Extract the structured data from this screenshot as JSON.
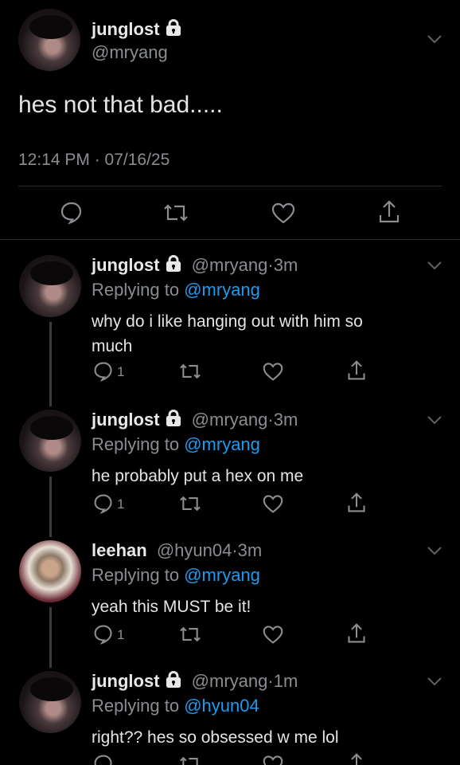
{
  "main_tweet": {
    "name": "junglost",
    "handle": "@mryang",
    "text": "hes not that bad.....",
    "timestamp": "12:14 PM · 07/16/25",
    "icons": [
      "lock-icon",
      "chevron-down-icon",
      "reply-icon",
      "retweet-icon",
      "like-icon",
      "share-icon"
    ]
  },
  "replies": [
    {
      "name": "junglost",
      "handle": "@mryang",
      "dot": "·",
      "time": "3m",
      "replying_prefix": "Replying to",
      "replying_to": "@mryang",
      "text_line1": "why do i like hanging out with him so",
      "text_line2": "much",
      "reply_count": "1",
      "locked": true
    },
    {
      "name": "junglost",
      "handle": "@mryang",
      "dot": "·",
      "time": "3m",
      "replying_prefix": "Replying to",
      "replying_to": "@mryang",
      "text_line1": "he probably put a hex on me",
      "reply_count": "1",
      "locked": true
    },
    {
      "name": "leehan",
      "handle": "@hyun04",
      "dot": "·",
      "time": "3m",
      "replying_prefix": "Replying to",
      "replying_to": "@mryang",
      "text_line1": "yeah this MUST be it!",
      "reply_count": "1",
      "locked": false
    },
    {
      "name": "junglost",
      "handle": "@mryang",
      "dot": "·",
      "time": "1m",
      "replying_prefix": "Replying to",
      "replying_to": "@hyun04",
      "text_line1": "right?? hes so obsessed w me lol",
      "locked": true
    }
  ],
  "colors": {
    "background": "#000000",
    "mention": "#1d9bf0",
    "muted": "#8a8d91",
    "text": "#e4e4e4"
  }
}
